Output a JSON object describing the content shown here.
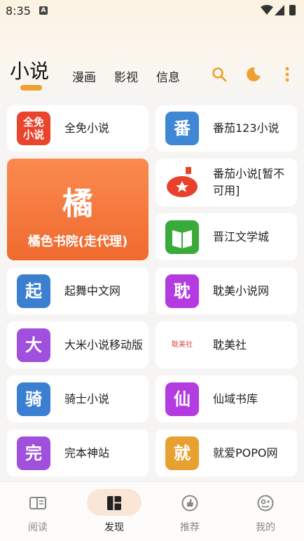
{
  "status_bar": {
    "time": "8:35",
    "notif_icon_letter": "A"
  },
  "header": {
    "active_tab": "小说",
    "tabs": [
      "漫画",
      "影视",
      "信息"
    ],
    "accent_color": "#f0a030"
  },
  "sources": [
    {
      "label": "全免小说",
      "icon_text": "全免\n小说",
      "color": "#e8452c"
    },
    {
      "label": "番茄123小说",
      "icon_text": "番",
      "color": "#3f86d4"
    },
    {
      "label": "番茄小说[暂不可用]",
      "icon_text": "",
      "color": "#e9412c"
    },
    {
      "label": "晋江文学城",
      "icon_text": "",
      "color": "#3aaa3a"
    },
    {
      "label": "起舞中文网",
      "icon_text": "起",
      "color": "#3b80d0"
    },
    {
      "label": "耽美小说网",
      "icon_text": "耽",
      "color": "#b43be0"
    },
    {
      "label": "大米小说移动版",
      "icon_text": "大",
      "color": "#a050dc"
    },
    {
      "label": "耽美社",
      "icon_text": "耽美社",
      "color": "#e04040"
    },
    {
      "label": "骑士小说",
      "icon_text": "骑",
      "color": "#3b80d0"
    },
    {
      "label": "仙域书库",
      "icon_text": "仙",
      "color": "#b43be0"
    },
    {
      "label": "完本神站",
      "icon_text": "完",
      "color": "#a050dc"
    },
    {
      "label": "就爱POPO网",
      "icon_text": "就",
      "color": "#e8a030"
    }
  ],
  "featured": {
    "char": "橘",
    "label": "橘色书院(走代理)"
  },
  "bottom_nav": [
    {
      "label": "阅读",
      "icon": "book-open-icon"
    },
    {
      "label": "发现",
      "icon": "grid-layout-icon"
    },
    {
      "label": "推荐",
      "icon": "thumb-up-icon"
    },
    {
      "label": "我的",
      "icon": "profile-icon"
    }
  ]
}
